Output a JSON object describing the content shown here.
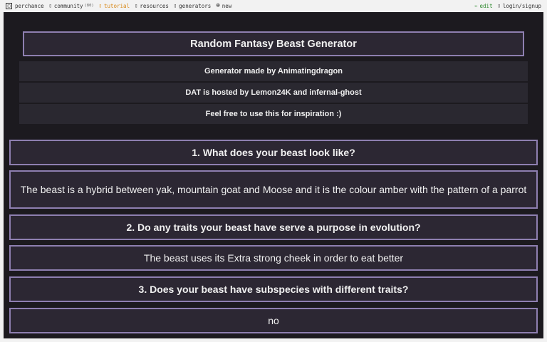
{
  "topbar": {
    "brand": "perchance",
    "community": "community",
    "community_count": "(80)",
    "tutorial": "tutorial",
    "resources": "resources",
    "generators": "generators",
    "new": "new",
    "edit": "edit",
    "login": "login/signup"
  },
  "title": "Random Fantasy Beast Generator",
  "info": [
    "Generator made by Animatingdragon",
    "DAT is hosted by Lemon24K and infernal-ghost",
    "Feel free to use this for inspiration :)"
  ],
  "questions": [
    {
      "question": "1. What does your beast look like?",
      "answer": "The beast is a hybrid between yak, mountain goat and Moose and it is the colour amber with the pattern of a parrot"
    },
    {
      "question": "2. Do any traits your beast have serve a purpose in evolution?",
      "answer": "The beast uses its Extra strong cheek in order to eat better"
    },
    {
      "question": "3. Does your beast have subspecies with different traits?",
      "answer": "no"
    }
  ]
}
